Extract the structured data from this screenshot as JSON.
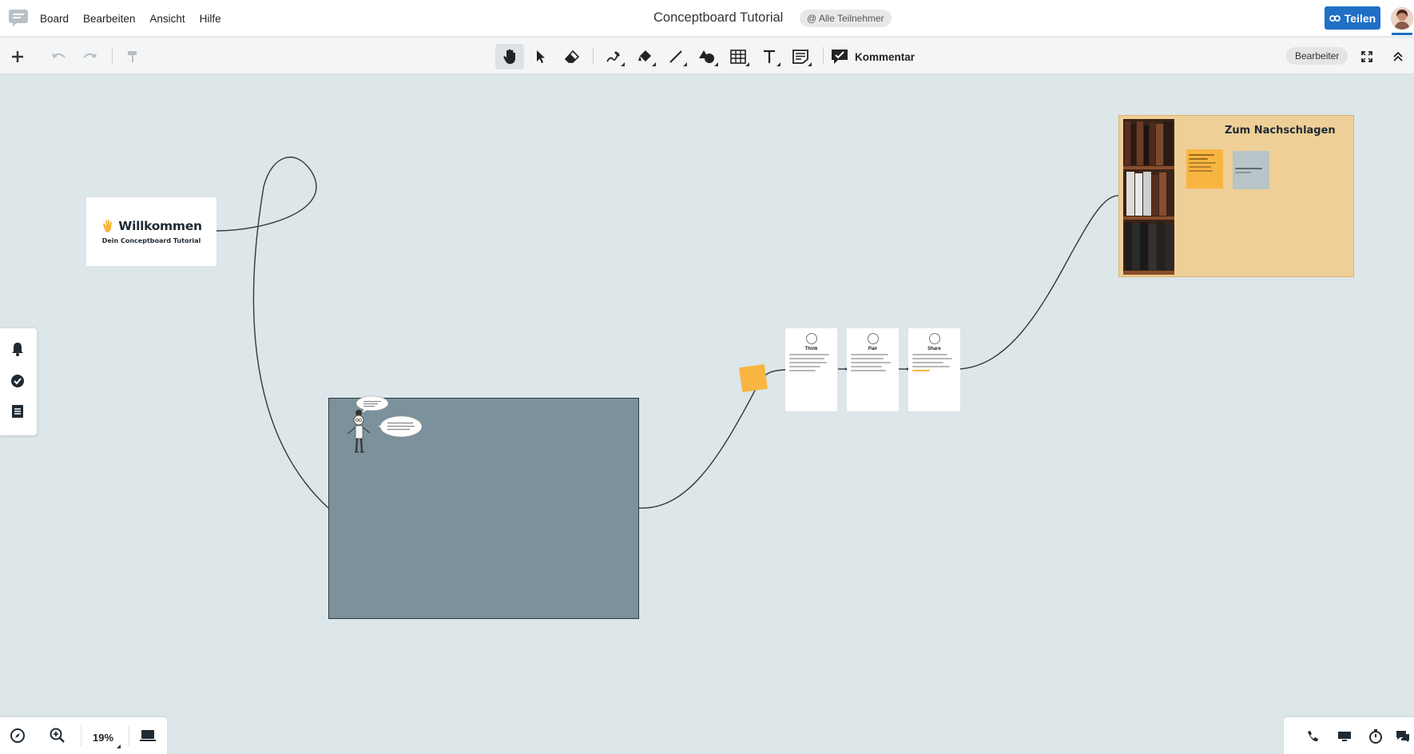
{
  "topbar": {
    "menu": [
      "Board",
      "Bearbeiten",
      "Ansicht",
      "Hilfe"
    ],
    "title": "Conceptboard Tutorial",
    "participants": "@ Alle Teilnehmer",
    "share_label": "Teilen"
  },
  "toolbar": {
    "comment_label": "Kommentar",
    "role_badge": "Bearbeiter"
  },
  "canvas": {
    "welcome_title": "Willkommen",
    "welcome_subtitle": "Dein Conceptboard Tutorial",
    "think_pair_share": [
      "Think",
      "Pair",
      "Share"
    ],
    "reference_title": "Zum Nachschlagen"
  },
  "bottom": {
    "zoom": "19%"
  },
  "colors": {
    "canvas": "#dde6e8",
    "accent": "#1f6fc5",
    "frame": "#7b919c",
    "sticky": "#f8b541",
    "reference": "#eecf98"
  }
}
